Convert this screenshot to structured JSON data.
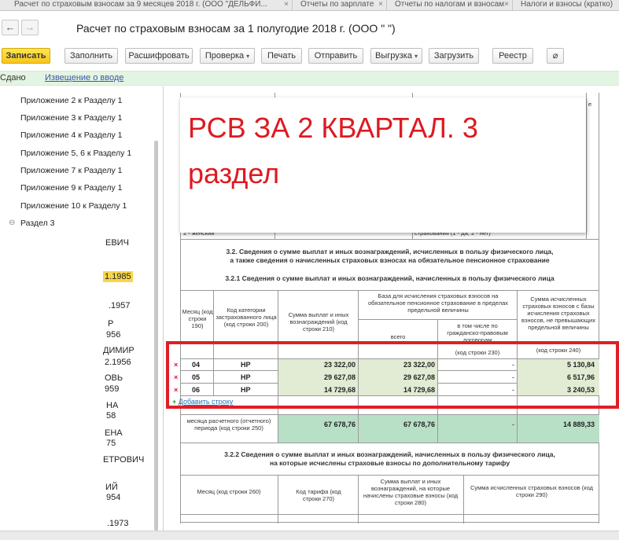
{
  "tabs": [
    {
      "label": "Расчет по страховым взносам за 9 месяцев 2018 г. (ООО \"ДЕЛЬФИ..."
    },
    {
      "label": "Отчеты по зарплате"
    },
    {
      "label": "Отчеты по налогам и взносам"
    },
    {
      "label": "Налоги и взносы (кратко)"
    }
  ],
  "window": {
    "title": "Расчет по страховым взносам за 1 полугодие 2018 г. (ООО \"                \")",
    "back_icon": "←",
    "forward_icon": "→"
  },
  "toolbar": {
    "record": "Записать",
    "fill": "Заполнить",
    "decode": "Расшифровать",
    "check": "Проверка",
    "print": "Печать",
    "send": "Отправить",
    "export": "Выгрузка",
    "load": "Загрузить",
    "registry": "Реестр",
    "caret": "▾",
    "clip_icon": "⌀"
  },
  "status": {
    "state": "Сдано",
    "notice": "Извещение о вводе"
  },
  "tree": {
    "items": [
      "Приложение 2 к Разделу 1",
      "Приложение 3 к Разделу 1",
      "Приложение 4 к Разделу 1",
      "Приложение 5, 6 к Разделу 1",
      "Приложение 7 к Разделу 1",
      "Приложение 9 к Разделу 1",
      "Приложение 10 к Разделу 1",
      "Раздел 3"
    ],
    "toggle": "⊖"
  },
  "left_fragments": [
    "ЕВИЧ",
    "1.1985",
    ".1957",
    "Р",
    "956",
    "ДИМИР",
    "2.1956",
    "ОВЬ",
    "959",
    "НА",
    "58",
    "ЕНА",
    "75",
    "ЕТРОВИЧ",
    "ИЙ",
    "954",
    ".1973"
  ],
  "overlay": {
    "line1": "РСВ ЗА 2 КВАРТАЛ. 3",
    "line2": "раздел"
  },
  "doc": {
    "gender_fragment": "2 - женский",
    "ins_fragment": "страхования (1 - да, 2 - нет)",
    "right_top_fragment": "е",
    "section_32_line1": "3.2. Сведения о сумме выплат и иных вознаграждений, исчисленных в пользу физического лица,",
    "section_32_line2": "а также сведения о начисленных страховых взносах на обязательное пенсионное страхование",
    "section_321": "3.2.1 Сведения о сумме выплат и иных вознаграждений, начисленных в пользу физического лица",
    "section_322_line1": "3.2.2 Сведения о сумме выплат и иных вознаграждений, начисленных в пользу физического лица,",
    "section_322_line2": "на которые исчислены страховые взносы по дополнительному тарифу"
  },
  "table": {
    "headers": {
      "month": "Месяц (код строки 190)",
      "category": "Код категории застрахованного лица (код строки 200)",
      "sum": "Сумма выплат и иных вознаграждений (код строки 210)",
      "base": "База для исчисления страховых взносов на обязательное пенсионное страхование в пределах предельной величины",
      "base_total": "всего",
      "base_gpd": "в том числе по гражданско-правовым договорам",
      "base_gpd_code": "(код строки 230)",
      "contrib": "Сумма исчисленных страховых взносов с базы исчисления страховых взносов, не превышающих предельной величины",
      "contrib_code": "(код строки 240)"
    },
    "rows": [
      {
        "month": "04",
        "category": "НР",
        "sum": "23 322,00",
        "base": "23 322,00",
        "gpd": "-",
        "contrib": "5 130,84"
      },
      {
        "month": "05",
        "category": "НР",
        "sum": "29 627,08",
        "base": "29 627,08",
        "gpd": "-",
        "contrib": "6 517,96"
      },
      {
        "month": "06",
        "category": "НР",
        "sum": "14 729,68",
        "base": "14 729,68",
        "gpd": "-",
        "contrib": "3 240,53"
      }
    ],
    "row_delete": "×",
    "add_row": "Добавить строку",
    "add_plus": "+",
    "total_label": "месяца расчетного (отчетного) периода (код строки 250)",
    "totals": {
      "sum": "67 678,76",
      "base": "67 678,76",
      "gpd": "-",
      "contrib": "14 889,33"
    }
  },
  "table2": {
    "month": "Месяц (код строки 260)",
    "tariff": "Код тарифа (код строки 270)",
    "sum": "Сумма выплат и иных вознаграждений, на которые начислены страховые взносы (код строки 280)",
    "contrib": "Сумма исчисленных страховых взносов (код строки 290)"
  }
}
